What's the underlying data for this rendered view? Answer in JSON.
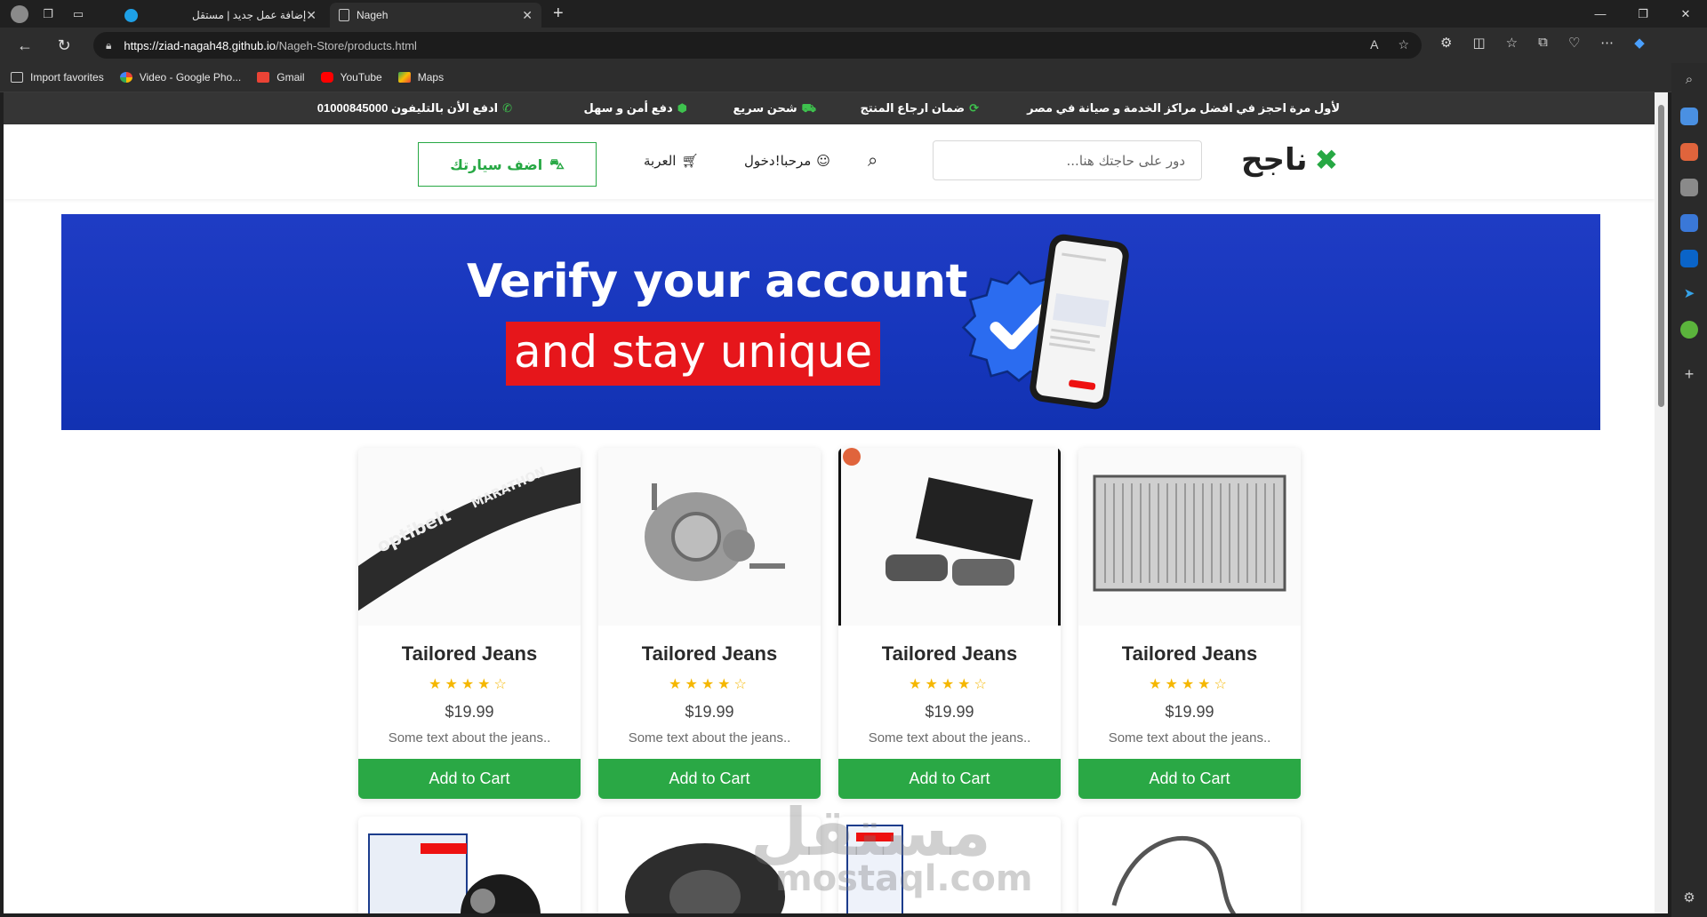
{
  "browser": {
    "tabs": [
      {
        "title": "إضافة عمل جديد | مستقل",
        "icon_color": "#1ea0e6"
      },
      {
        "title": "Nageh",
        "icon_color": "#e6e6e6"
      }
    ],
    "new_tab_label": "+",
    "url_host": "https://ziad-nagah48.github.io",
    "url_path": "/Nageh-Store/products.html",
    "favorites": [
      {
        "label": "Import favorites",
        "icon": "import-icon",
        "color": "#cfcfcf"
      },
      {
        "label": "Video - Google Pho...",
        "icon": "google-photos-icon",
        "color": "#f4b400"
      },
      {
        "label": "Gmail",
        "icon": "gmail-icon",
        "color": "#ea4335"
      },
      {
        "label": "YouTube",
        "icon": "youtube-icon",
        "color": "#ff0000"
      },
      {
        "label": "Maps",
        "icon": "maps-icon",
        "color": "#34a853"
      }
    ]
  },
  "site": {
    "topbar": {
      "offer": "لأول مرة احجز في افضل مراكز الخدمة و صيانة في مصر",
      "return": "ضمان ارجاع المنتج",
      "shipping": "شحن سريع",
      "payment": "دفع أمن و سهل",
      "phone": "ادفع الأن بالتليفون 01000845000"
    },
    "header": {
      "logo": "ناجح",
      "search_placeholder": "دور على حاجتك هنا...",
      "login": "مرحبا!دخول",
      "cart": "العربة",
      "add_car": "اضف سيارتك"
    },
    "banner": {
      "line1": "Verify your account",
      "line2": "and stay unique"
    },
    "accent_color": "#27a844",
    "products": [
      {
        "title": "Tailored Jeans",
        "stars": "★★★★☆",
        "price": "$19.99",
        "desc": "Some text about the jeans..",
        "button": "Add to Cart",
        "image": "timing-belt"
      },
      {
        "title": "Tailored Jeans",
        "stars": "★★★★☆",
        "price": "$19.99",
        "desc": "Some text about the jeans..",
        "button": "Add to Cart",
        "image": "water-pump"
      },
      {
        "title": "Tailored Jeans",
        "stars": "★★★★☆",
        "price": "$19.99",
        "desc": "Some text about the jeans..",
        "button": "Add to Cart",
        "image": "brake-pads"
      },
      {
        "title": "Tailored Jeans",
        "stars": "★★★★☆",
        "price": "$19.99",
        "desc": "Some text about the jeans..",
        "button": "Add to Cart",
        "image": "radiator"
      }
    ],
    "watermark": "مستقل",
    "watermark_sub": "mostaql.com"
  }
}
